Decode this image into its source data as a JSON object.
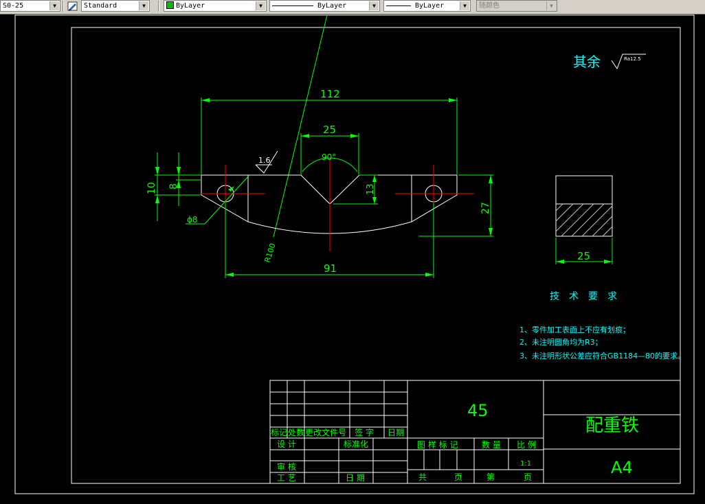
{
  "toolbar": {
    "dimstyle": "S0-25",
    "textstyle": "Standard",
    "layer_color": "ByLayer",
    "linetype": "ByLayer",
    "lineweight": "ByLayer",
    "plot_style": "随颜色",
    "layer_swatch_color": "#00c000"
  },
  "drawing": {
    "roughness_prefix": "其余",
    "roughness_value": "Ra12.5",
    "surface_finish": "1.6",
    "dims": {
      "overall_width": "112",
      "v_top_width": "25",
      "v_angle": "90°",
      "v_depth": "13",
      "height_10": "10",
      "height_8": "8",
      "right_height": "27",
      "hole_diameter": "ϕ8",
      "radius": "R100",
      "hole_spacing": "91",
      "thickness": "25"
    },
    "tech_title": "技术要求",
    "notes": [
      "1、零件加工表面上不应有划痕；",
      "2、未注明圆角均为R3；",
      "3、未注明形状公差应符合GB1184—80的要求。"
    ]
  },
  "title_block": {
    "row_labels": [
      "标记",
      "处数",
      "更改文件号",
      "签 字",
      "日期"
    ],
    "design": "设 计",
    "standardize": "标准化",
    "review": "审 核",
    "process": "工 艺",
    "date": "日 期",
    "material": "45",
    "stage_mark": "图 样 标 记",
    "quantity": "数 量",
    "scale_label": "比 例",
    "scale": "1:1",
    "total": "共",
    "page1": "页",
    "nth": "第",
    "page2": "页",
    "part_name": "配重铁",
    "paper_size": "A4"
  },
  "colors": {
    "outline": "#ffffff",
    "dimension": "#00ff00",
    "center": "#ff0000",
    "text_cyan": "#00ffff",
    "hatch": "#c0c0c0"
  }
}
